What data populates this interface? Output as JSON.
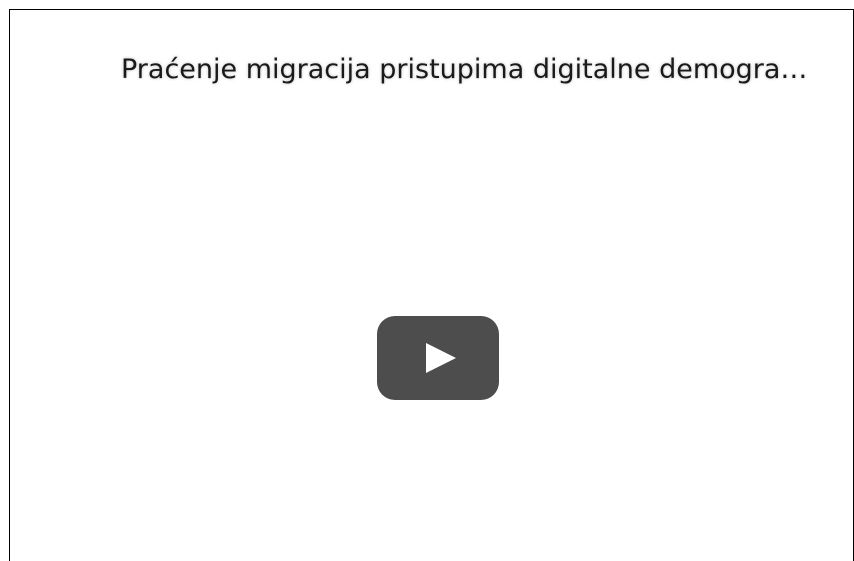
{
  "video": {
    "title": "Praćenje migracija pristupima digitalne demogra…",
    "play_icon": "play-icon",
    "colors": {
      "play_button_bg": "#4d4d4d",
      "play_triangle": "#ffffff",
      "border": "#000000"
    }
  }
}
